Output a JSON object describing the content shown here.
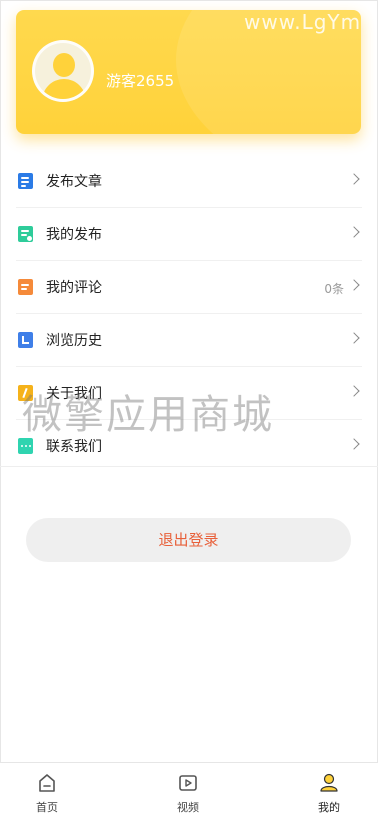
{
  "header": {
    "username": "游客2655",
    "watermark": "www.LgYm.cn"
  },
  "menu": {
    "items": [
      {
        "label": "发布文章",
        "extra": "",
        "icon": "document-icon",
        "color": "#2b7be6"
      },
      {
        "label": "我的发布",
        "extra": "",
        "icon": "publish-clock-icon",
        "color": "#2ecc9a"
      },
      {
        "label": "我的评论",
        "extra": "0条",
        "icon": "comment-icon",
        "color": "#f58a3a"
      },
      {
        "label": "浏览历史",
        "extra": "",
        "icon": "history-icon",
        "color": "#3f7fe8"
      },
      {
        "label": "关于我们",
        "extra": "",
        "icon": "about-icon",
        "color": "#f5b21a"
      },
      {
        "label": "联系我们",
        "extra": "",
        "icon": "contact-icon",
        "color": "#2fd4b0"
      }
    ]
  },
  "logout": {
    "label": "退出登录"
  },
  "overlay_watermark": "微擎应用商城",
  "tabbar": {
    "items": [
      {
        "label": "首页",
        "icon": "home-icon"
      },
      {
        "label": "视频",
        "icon": "video-icon"
      },
      {
        "label": "我的",
        "icon": "profile-icon",
        "active": true
      }
    ]
  },
  "colors": {
    "accent": "#ffd23a",
    "logout_text": "#e8603a"
  }
}
